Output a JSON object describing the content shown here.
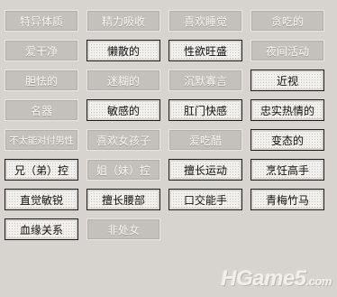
{
  "traits": [
    {
      "label": "特异体质",
      "active": false
    },
    {
      "label": "精力吸收",
      "active": false
    },
    {
      "label": "喜欢睡觉",
      "active": false
    },
    {
      "label": "贪吃的",
      "active": false
    },
    {
      "label": "爱干净",
      "active": false
    },
    {
      "label": "懒散的",
      "active": true
    },
    {
      "label": "性欲旺盛",
      "active": true
    },
    {
      "label": "夜间活动",
      "active": false
    },
    {
      "label": "胆怯的",
      "active": false
    },
    {
      "label": "迷糊的",
      "active": false
    },
    {
      "label": "沉默寡言",
      "active": false
    },
    {
      "label": "近视",
      "active": true
    },
    {
      "label": "名器",
      "active": false
    },
    {
      "label": "敏感的",
      "active": true
    },
    {
      "label": "肛门快感",
      "active": true
    },
    {
      "label": "忠实热情的",
      "active": true
    },
    {
      "label": "不太能对付男性",
      "active": false
    },
    {
      "label": "喜欢女孩子",
      "active": false
    },
    {
      "label": "爱吃醋",
      "active": false
    },
    {
      "label": "变态的",
      "active": true
    },
    {
      "label": "兄（弟）控",
      "active": true
    },
    {
      "label": "姐（妹）控",
      "active": false
    },
    {
      "label": "擅长运动",
      "active": true
    },
    {
      "label": "烹饪高手",
      "active": true
    },
    {
      "label": "直觉敏锐",
      "active": true
    },
    {
      "label": "擅长腰部",
      "active": true
    },
    {
      "label": "口交能手",
      "active": true
    },
    {
      "label": "青梅竹马",
      "active": true
    },
    {
      "label": "血缘关系",
      "active": true
    },
    {
      "label": "非处女",
      "active": false
    }
  ],
  "watermark": {
    "main": "HGame5",
    "suffix": ".com"
  }
}
